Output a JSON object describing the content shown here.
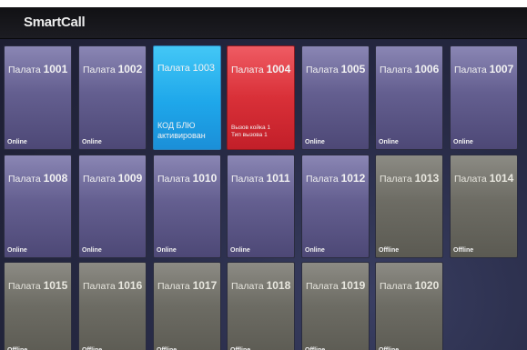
{
  "app": {
    "logo": "SmartCall"
  },
  "rooms": [
    {
      "label": "Палата",
      "num": "1001",
      "state": "online",
      "status": "Online"
    },
    {
      "label": "Палата",
      "num": "1002",
      "state": "online",
      "status": "Online"
    },
    {
      "label": "Палата",
      "num": "1003",
      "state": "code-blue",
      "status": "",
      "msg1": "КОД БЛЮ",
      "msg2": "активирован"
    },
    {
      "label": "Палата",
      "num": "1004",
      "state": "alarm",
      "status": "",
      "msg1": "Вызов койка 1",
      "msg2": "Тип вызова 1"
    },
    {
      "label": "Палата",
      "num": "1005",
      "state": "online",
      "status": "Online"
    },
    {
      "label": "Палата",
      "num": "1006",
      "state": "online",
      "status": "Online"
    },
    {
      "label": "Палата",
      "num": "1007",
      "state": "online",
      "status": "Online"
    },
    {
      "label": "Палата",
      "num": "1008",
      "state": "online",
      "status": "Online"
    },
    {
      "label": "Палата",
      "num": "1009",
      "state": "online",
      "status": "Online"
    },
    {
      "label": "Палата",
      "num": "1010",
      "state": "online",
      "status": "Online"
    },
    {
      "label": "Палата",
      "num": "1011",
      "state": "online",
      "status": "Online"
    },
    {
      "label": "Палата",
      "num": "1012",
      "state": "online",
      "status": "Online"
    },
    {
      "label": "Палата",
      "num": "1013",
      "state": "offline",
      "status": "Offline"
    },
    {
      "label": "Палата",
      "num": "1014",
      "state": "offline",
      "status": "Offline"
    },
    {
      "label": "Палата",
      "num": "1015",
      "state": "offline",
      "status": "Offline"
    },
    {
      "label": "Палата",
      "num": "1016",
      "state": "offline",
      "status": "Offline"
    },
    {
      "label": "Палата",
      "num": "1017",
      "state": "offline",
      "status": "Offline"
    },
    {
      "label": "Палата",
      "num": "1018",
      "state": "offline",
      "status": "Offline"
    },
    {
      "label": "Палата",
      "num": "1019",
      "state": "offline",
      "status": "Offline"
    },
    {
      "label": "Палата",
      "num": "1020",
      "state": "offline",
      "status": "Offline"
    }
  ],
  "colors": {
    "online": "#645f90",
    "offline": "#6d6c64",
    "code_blue": "#1ea7ea",
    "alarm": "#d93038"
  }
}
